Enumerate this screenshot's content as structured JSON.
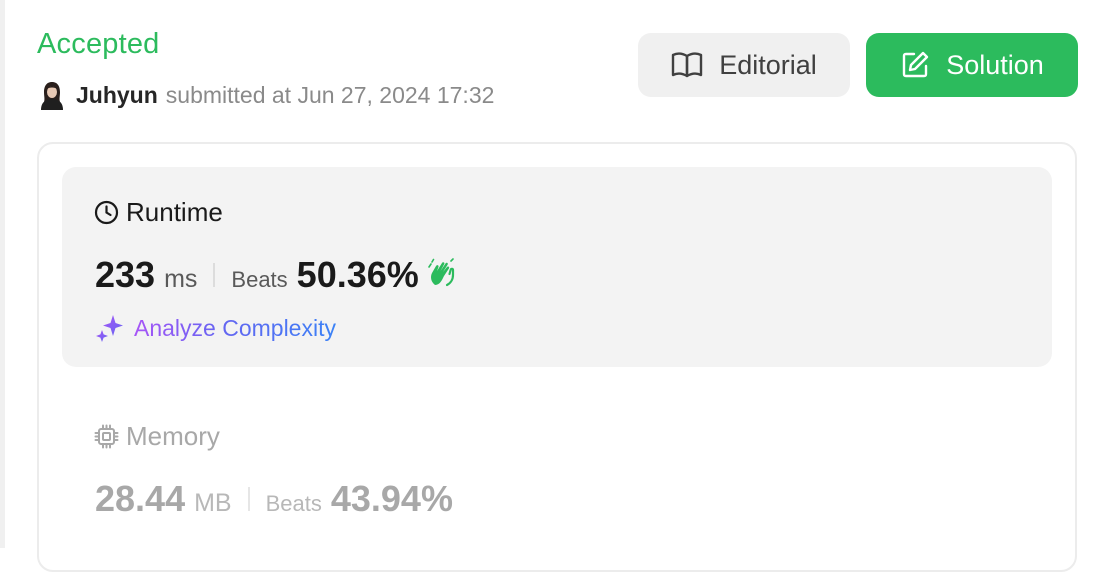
{
  "submission": {
    "status": "Accepted",
    "username": "Juhyun",
    "submitted_text": "submitted at Jun 27, 2024 17:32"
  },
  "buttons": {
    "editorial_label": "Editorial",
    "solution_label": "Solution"
  },
  "runtime": {
    "title": "Runtime",
    "value": "233",
    "unit": "ms",
    "beats_label": "Beats",
    "beats_value": "50.36%",
    "analyze_label": "Analyze Complexity"
  },
  "memory": {
    "title": "Memory",
    "value": "28.44",
    "unit": "MB",
    "beats_label": "Beats",
    "beats_value": "43.94%"
  },
  "colors": {
    "accepted": "#2cbb5d",
    "primary_text": "#1a1a1a",
    "muted_text": "#8a8a8a",
    "memory_text": "#b3b3b3",
    "panel_bg": "#f3f3f3"
  }
}
